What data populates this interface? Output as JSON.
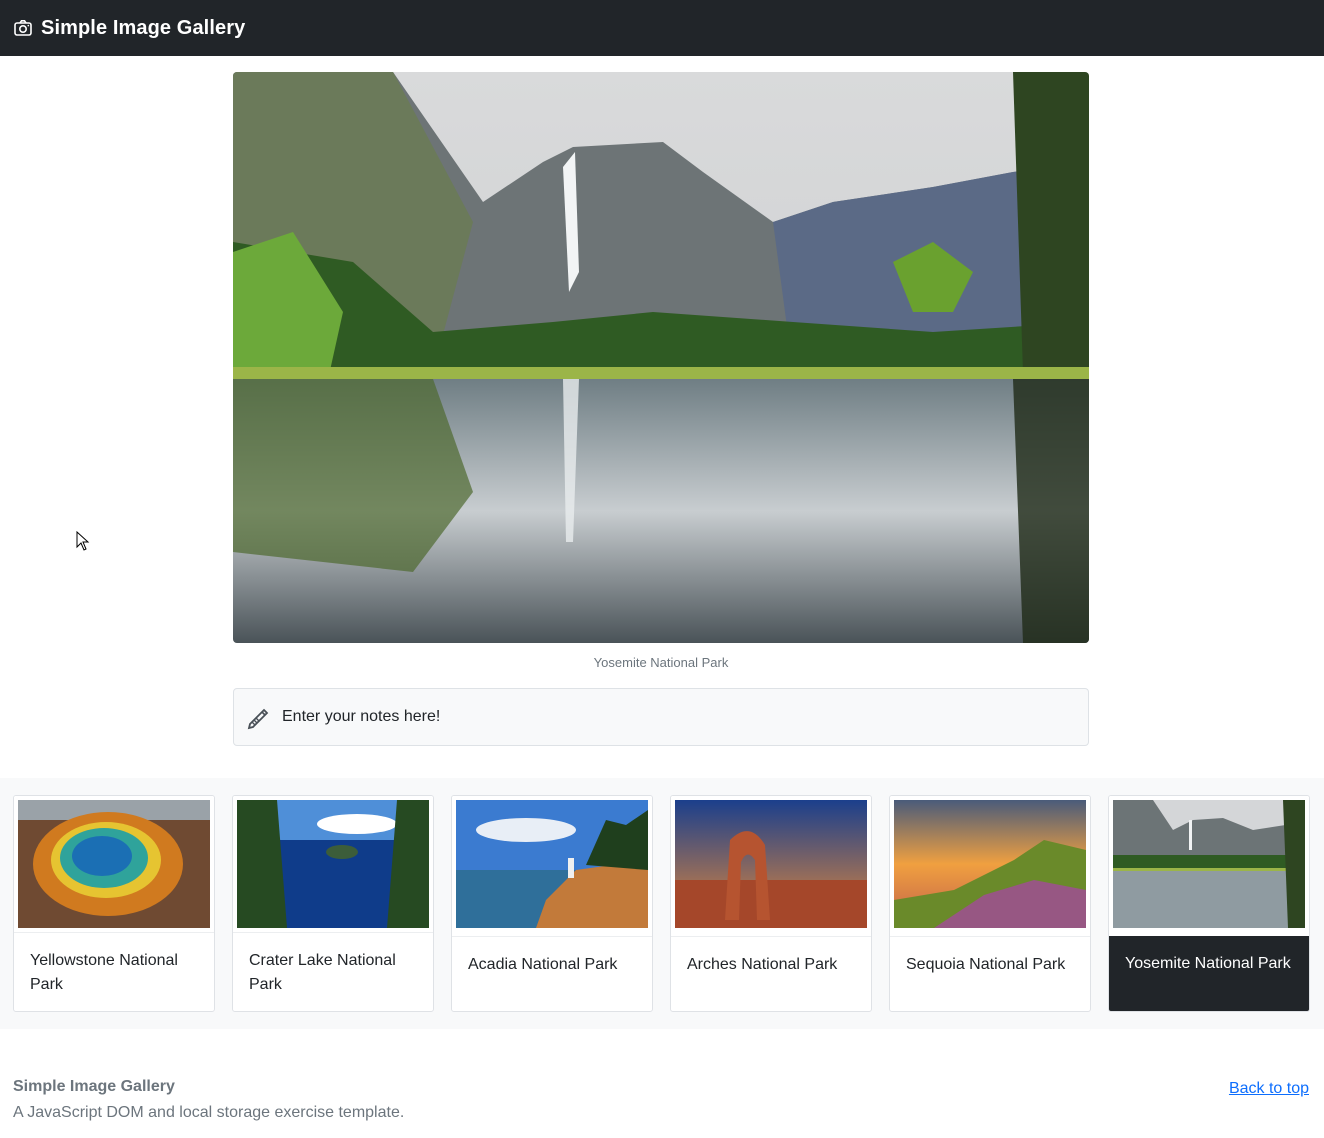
{
  "navbar": {
    "title": "Simple Image Gallery",
    "icon": "camera-icon"
  },
  "main": {
    "caption": "Yosemite National Park"
  },
  "notes": {
    "placeholder": "Enter your notes here!",
    "value": "",
    "icon": "pencil-icon"
  },
  "gallery": {
    "items": [
      {
        "label": "Yellowstone National Park",
        "active": false
      },
      {
        "label": "Crater Lake National Park",
        "active": false
      },
      {
        "label": "Acadia National Park",
        "active": false
      },
      {
        "label": "Arches National Park",
        "active": false
      },
      {
        "label": "Sequoia National Park",
        "active": false
      },
      {
        "label": "Yosemite National Park",
        "active": true
      }
    ]
  },
  "footer": {
    "title": "Simple Image Gallery",
    "subtitle": "A JavaScript DOM and local storage exercise template.",
    "back_to_top": "Back to top"
  },
  "colors": {
    "navbar": "#212529",
    "strip": "#f8f9fa",
    "link": "#0d6efd",
    "active_card": "#212529"
  }
}
